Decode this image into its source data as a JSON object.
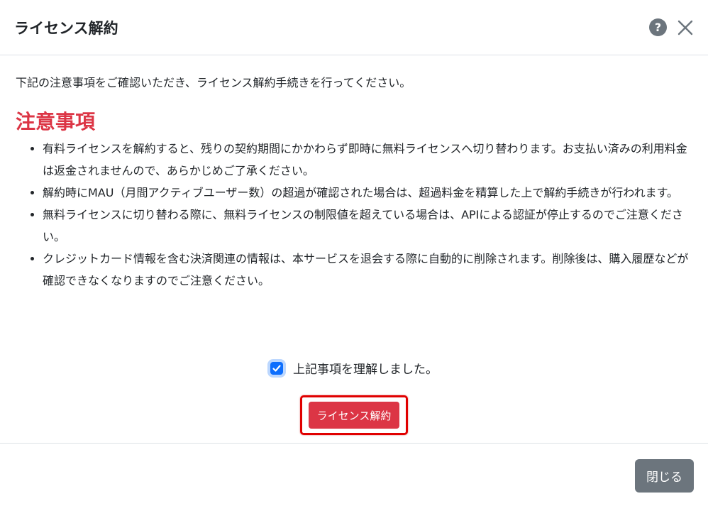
{
  "dialog": {
    "title": "ライセンス解約",
    "help_icon": "question-circle-icon",
    "close_icon": "close-x-icon"
  },
  "body": {
    "intro": "下記の注意事項をご確認いただき、ライセンス解約手続きを行ってください。",
    "notice_heading": "注意事項",
    "notices": [
      "有料ライセンスを解約すると、残りの契約期間にかかわらず即時に無料ライセンスへ切り替わります。お支払い済みの利用料金は返金されませんので、あらかじめご了承ください。",
      "解約時にMAU（月間アクティブユーザー数）の超過が確認された場合は、超過料金を精算した上で解約手続きが行われます。",
      "無料ライセンスに切り替わる際に、無料ライセンスの制限値を超えている場合は、APIによる認証が停止するのでご注意ください。",
      "クレジットカード情報を含む決済関連の情報は、本サービスを退会する際に自動的に削除されます。削除後は、購入履歴などが確認できなくなりますのでご注意ください。"
    ],
    "confirm_checkbox": {
      "label": "上記事項を理解しました。",
      "checked": true
    },
    "cancel_license_button": "ライセンス解約"
  },
  "footer": {
    "close_button": "閉じる"
  },
  "colors": {
    "danger": "#dc3545",
    "primary": "#0d6efd",
    "secondary": "#6c757d",
    "highlight_outline": "#e00000"
  }
}
